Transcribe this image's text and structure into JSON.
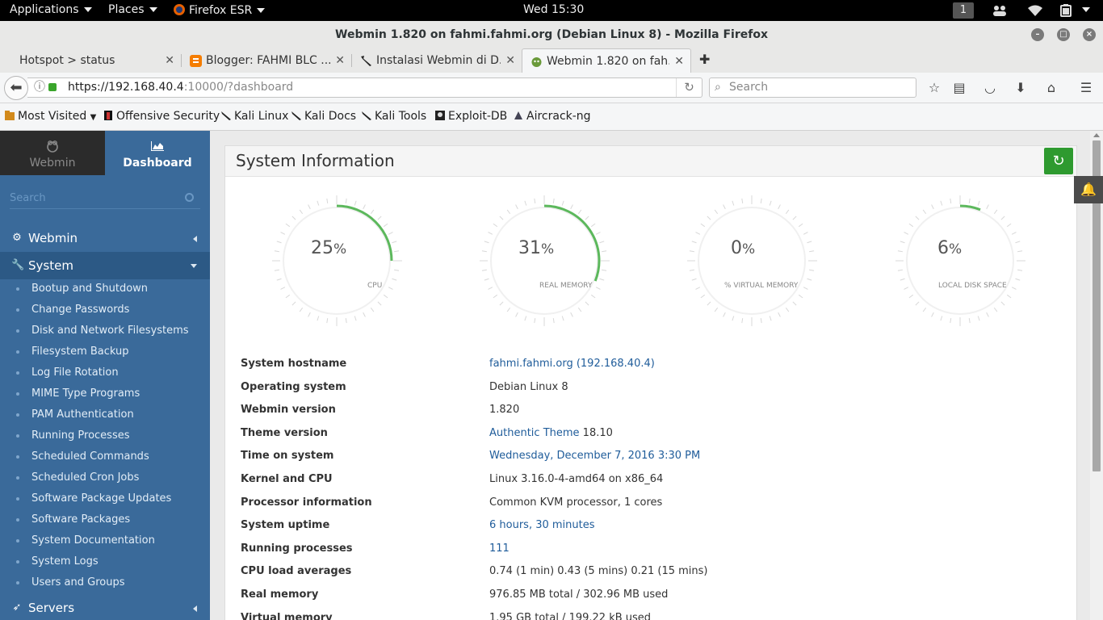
{
  "topbar": {
    "applications": "Applications",
    "places": "Places",
    "firefox": "Firefox ESR",
    "clock": "Wed 15:30",
    "workspace": "1"
  },
  "window": {
    "title": "Webmin 1.820 on fahmi.fahmi.org (Debian Linux 8) - Mozilla Firefox"
  },
  "tabs": [
    {
      "label": "Hotspot > status",
      "icon": "none"
    },
    {
      "label": "Blogger: FAHMI BLC ...",
      "icon": "blogger-icon"
    },
    {
      "label": "Instalasi Webmin di D...",
      "icon": "kali-dragon-icon"
    },
    {
      "label": "Webmin 1.820 on fah...",
      "icon": "webmin-icon"
    }
  ],
  "nav": {
    "url_host": "https://192.168.40.4",
    "url_rest": ":10000/?dashboard",
    "search_placeholder": "Search"
  },
  "bookmarks": [
    {
      "label": "Most Visited",
      "icon": "folder-icon"
    },
    {
      "label": "Offensive Security",
      "icon": "offsec-icon"
    },
    {
      "label": "Kali Linux",
      "icon": "kali-icon"
    },
    {
      "label": "Kali Docs",
      "icon": "kali-icon"
    },
    {
      "label": "Kali Tools",
      "icon": "kali-icon"
    },
    {
      "label": "Exploit-DB",
      "icon": "exploitdb-icon"
    },
    {
      "label": "Aircrack-ng",
      "icon": "aircrack-icon"
    }
  ],
  "sidebar": {
    "tab_webmin": "Webmin",
    "tab_dashboard": "Dashboard",
    "search_placeholder": "Search",
    "cat_webmin": "Webmin",
    "cat_system": "System",
    "cat_servers": "Servers",
    "items": [
      "Bootup and Shutdown",
      "Change Passwords",
      "Disk and Network Filesystems",
      "Filesystem Backup",
      "Log File Rotation",
      "MIME Type Programs",
      "PAM Authentication",
      "Running Processes",
      "Scheduled Commands",
      "Scheduled Cron Jobs",
      "Software Package Updates",
      "Software Packages",
      "System Documentation",
      "System Logs",
      "Users and Groups"
    ]
  },
  "main": {
    "title": "System Information",
    "gauges": [
      {
        "value": "25",
        "unit": "%",
        "label": "CPU",
        "percent": 25
      },
      {
        "value": "31",
        "unit": "%",
        "label": "REAL MEMORY",
        "percent": 31
      },
      {
        "value": "0",
        "unit": "%",
        "label": "VIRTUAL MEMORY",
        "percent": 0
      },
      {
        "value": "6",
        "unit": "%",
        "label": "LOCAL DISK SPACE",
        "percent": 6
      }
    ],
    "info": [
      {
        "key": "System hostname",
        "value": "fahmi.fahmi.org (192.168.40.4)",
        "link": true
      },
      {
        "key": "Operating system",
        "value": "Debian Linux 8",
        "link": false
      },
      {
        "key": "Webmin version",
        "value": "1.820",
        "link": false
      },
      {
        "key": "Theme version",
        "value_link": "Authentic Theme",
        "value": " 18.10",
        "link": "partial"
      },
      {
        "key": "Time on system",
        "value": "Wednesday, December 7, 2016 3:30 PM",
        "link": true
      },
      {
        "key": "Kernel and CPU",
        "value": "Linux 3.16.0-4-amd64 on x86_64",
        "link": false
      },
      {
        "key": "Processor information",
        "value": "Common KVM processor, 1 cores",
        "link": false
      },
      {
        "key": "System uptime",
        "value": "6 hours, 30 minutes",
        "link": true
      },
      {
        "key": "Running processes",
        "value": "111",
        "link": true
      },
      {
        "key": "CPU load averages",
        "value": "0.74 (1 min) 0.43 (5 mins) 0.21 (15 mins)",
        "link": false
      },
      {
        "key": "Real memory",
        "value": "976.85 MB total / 302.96 MB used",
        "link": false
      },
      {
        "key": "Virtual memory",
        "value": "1.95 GB total / 199.22 kB used",
        "link": false
      }
    ]
  },
  "colors": {
    "sidebar": "#3a6a9a",
    "gauge_arc": "#5cb85c",
    "link": "#1f5c9a",
    "refresh": "#2e9a2f"
  }
}
